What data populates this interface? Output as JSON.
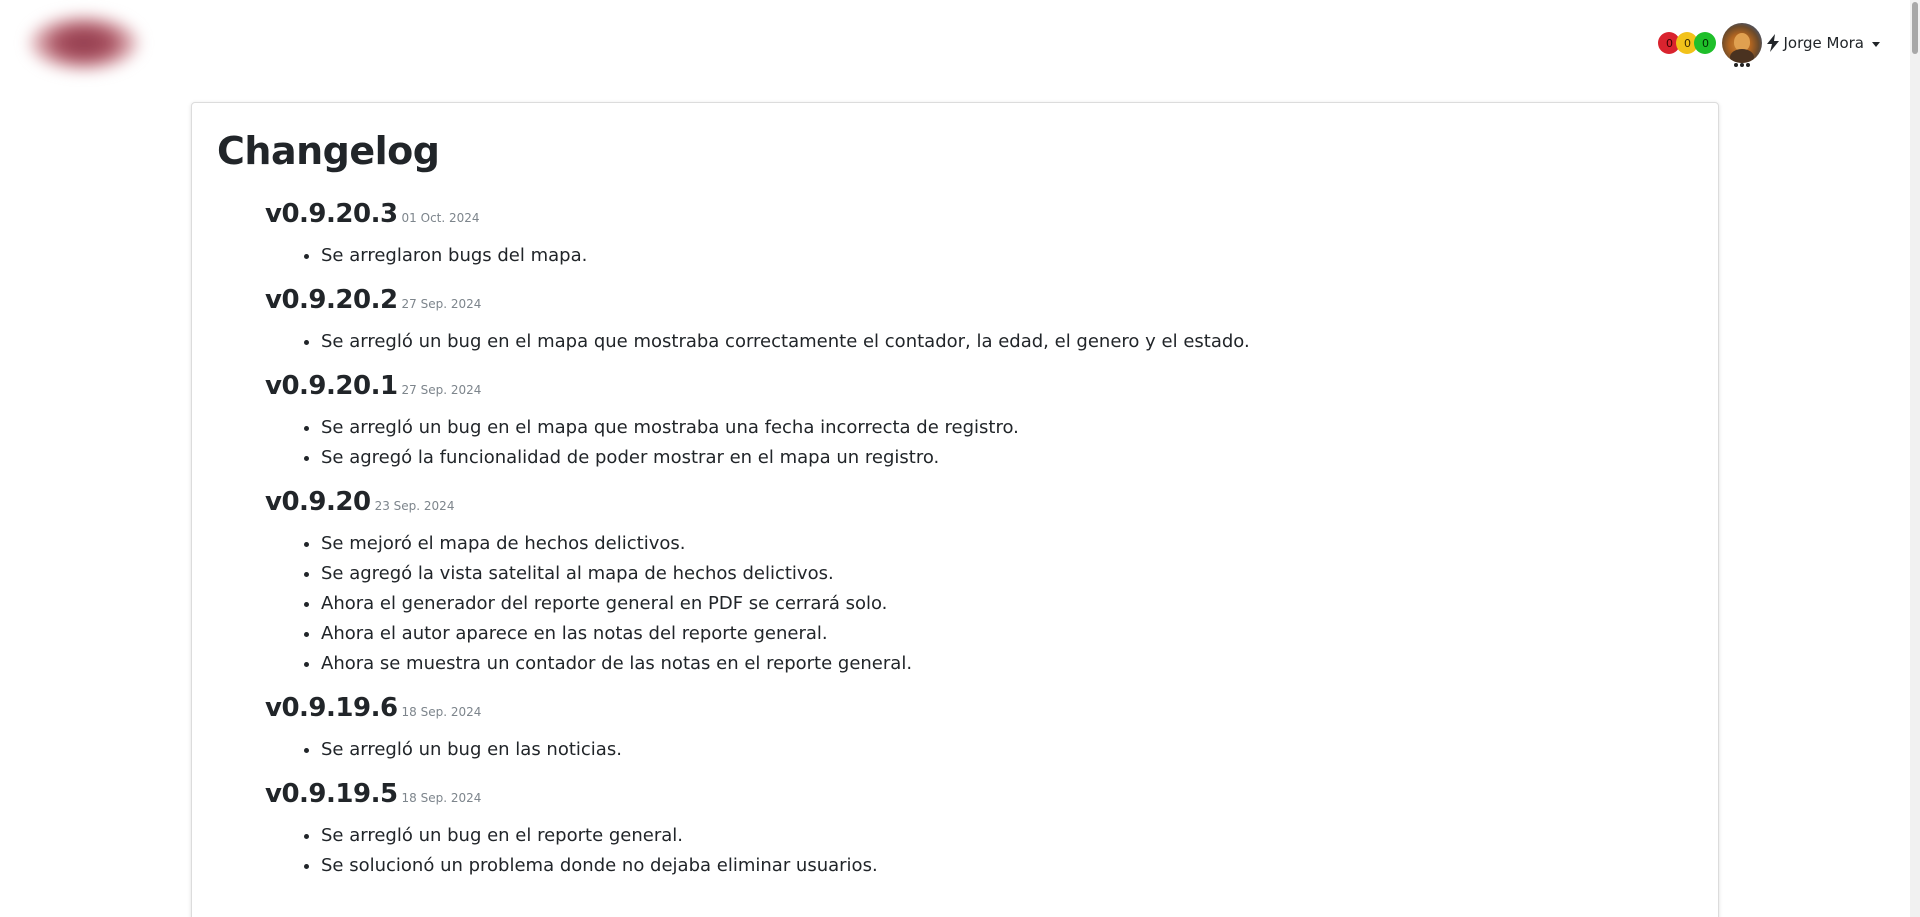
{
  "header": {
    "counters": [
      {
        "value": "0",
        "color": "#d9232e"
      },
      {
        "value": "0",
        "color": "#f2c21a"
      },
      {
        "value": "0",
        "color": "#1fbf2a"
      }
    ],
    "user_name": "Jorge Mora",
    "icons": [
      "avatar",
      "bolt-icon",
      "caret-down-icon"
    ]
  },
  "page": {
    "title": "Changelog"
  },
  "versions": [
    {
      "name": "v0.9.20.3",
      "date": "01 Oct. 2024",
      "changes": [
        "Se arreglaron bugs del mapa."
      ]
    },
    {
      "name": "v0.9.20.2",
      "date": "27 Sep. 2024",
      "changes": [
        "Se arregló un bug en el mapa que mostraba correctamente el contador, la edad, el genero y el estado."
      ]
    },
    {
      "name": "v0.9.20.1",
      "date": "27 Sep. 2024",
      "changes": [
        "Se arregló un bug en el mapa que mostraba una fecha incorrecta de registro.",
        "Se agregó la funcionalidad de poder mostrar en el mapa un registro."
      ]
    },
    {
      "name": "v0.9.20",
      "date": "23 Sep. 2024",
      "changes": [
        "Se mejoró el mapa de hechos delictivos.",
        "Se agregó la vista satelital al mapa de hechos delictivos.",
        "Ahora el generador del reporte general en PDF se cerrará solo.",
        "Ahora el autor aparece en las notas del reporte general.",
        "Ahora se muestra un contador de las notas en el reporte general."
      ]
    },
    {
      "name": "v0.9.19.6",
      "date": "18 Sep. 2024",
      "changes": [
        "Se arregló un bug en las noticias."
      ]
    },
    {
      "name": "v0.9.19.5",
      "date": "18 Sep. 2024",
      "changes": [
        "Se arregló un bug en el reporte general.",
        "Se solucionó un problema donde no dejaba eliminar usuarios."
      ]
    }
  ]
}
